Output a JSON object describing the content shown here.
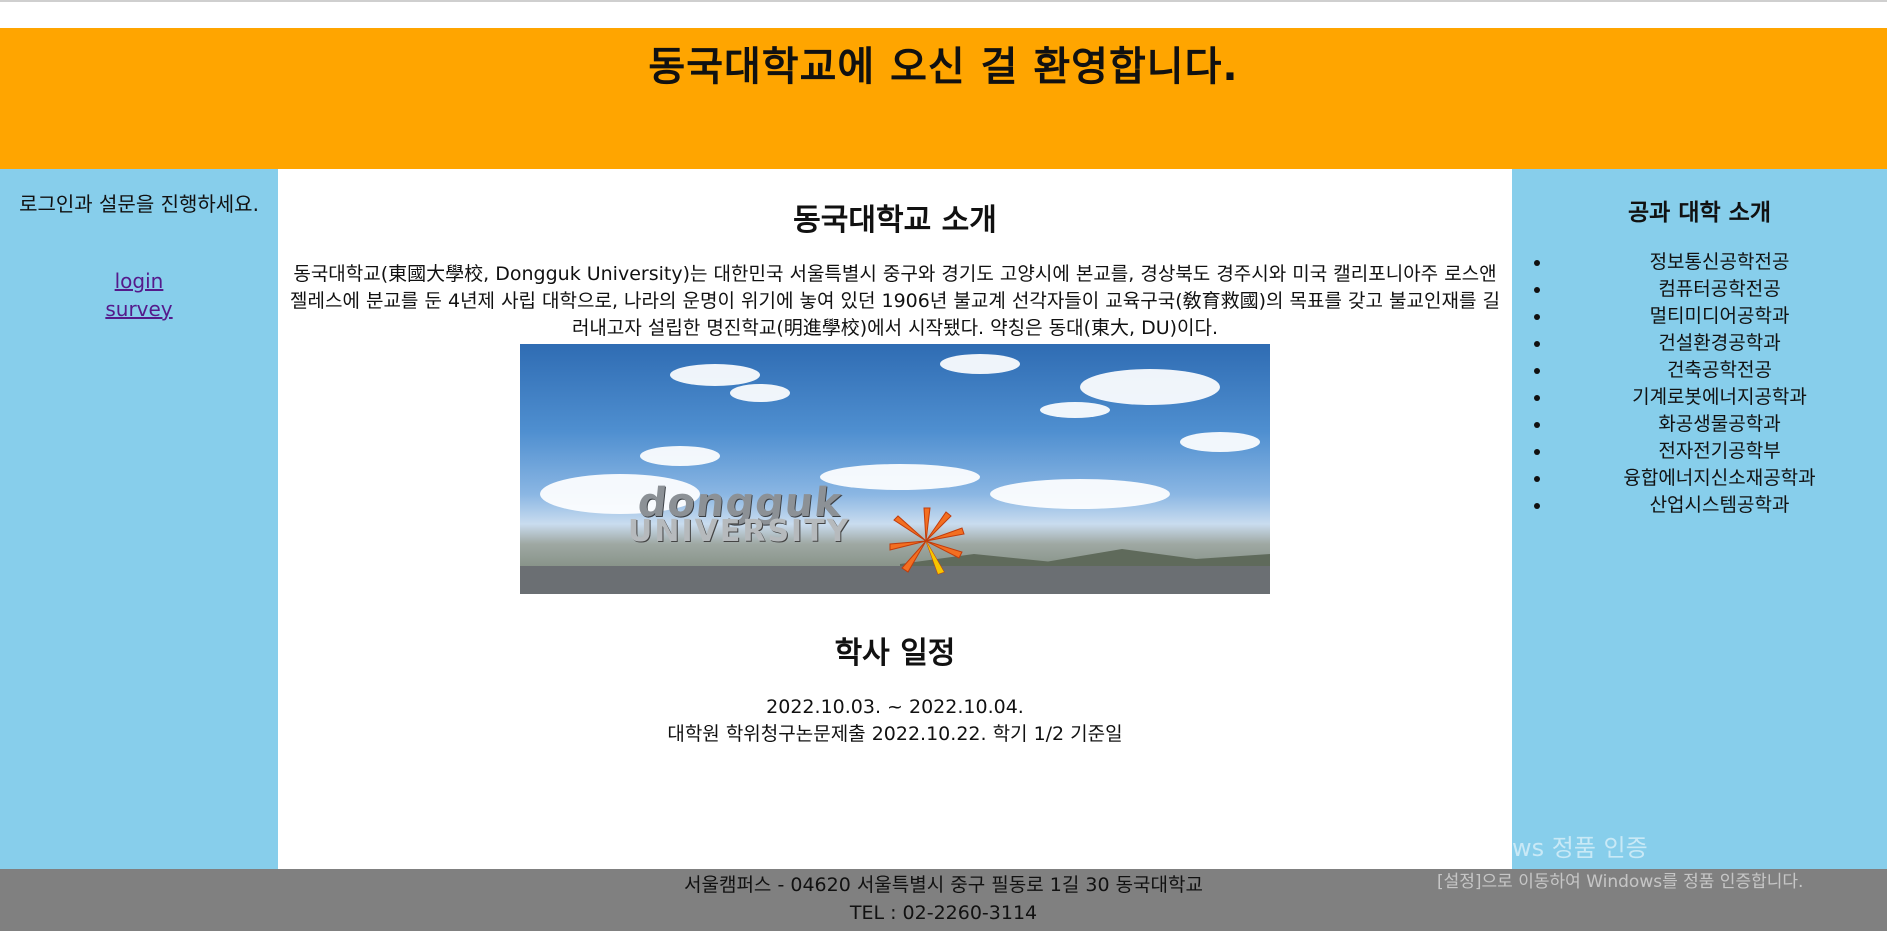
{
  "header": {
    "title": "동국대학교에 오신 걸 환영합니다."
  },
  "left": {
    "message": "로그인과 설문을 진행하세요.",
    "links": [
      "login",
      "survey"
    ]
  },
  "main": {
    "intro_title": "동국대학교 소개",
    "intro_text": "동국대학교(東國大學校, Dongguk University)는 대한민국 서울특별시 중구와 경기도 고양시에 본교를, 경상북도 경주시와 미국 캘리포니아주 로스앤젤레스에 분교를 둔 4년제 사립 대학으로, 나라의 운명이 위기에 놓여 있던 1906년 불교계 선각자들이 교육구국(敎育救國)의 목표를 갖고 불교인재를 길러내고자 설립한 명진학교(明進學校)에서 시작됐다. 약칭은 동대(東大, DU)이다.",
    "photo_sign": "dongguk",
    "photo_sign_2": "UNIVERSITY",
    "schedule_title": "학사 일정",
    "schedule_lines": [
      "2022.10.03. ~ 2022.10.04.",
      "대학원 학위청구논문제출 2022.10.22. 학기 1/2 기준일"
    ]
  },
  "right": {
    "title": "공과 대학 소개",
    "departments": [
      "정보통신공학전공",
      "컴퓨터공학전공",
      "멀티미디어공학과",
      "건설환경공학과",
      "건축공학전공",
      "기계로봇에너지공학과",
      "화공생물공학과",
      "전자전기공학부",
      "융합에너지신소재공학과",
      "산업시스템공학과"
    ]
  },
  "footer": {
    "address": "서울캠퍼스 - 04620 서울특별시 중구 필동로 1길 30 동국대학교",
    "tel": "TEL : 02-2260-3114"
  },
  "watermark": {
    "line1": "Windows 정품 인증",
    "line2": "[설정]으로 이동하여 Windows를 정품 인증합니다."
  },
  "colors": {
    "header_bg": "#ffa500",
    "sidebar_bg": "#87ceeb",
    "footer_bg": "#808080",
    "link": "#551a8b"
  }
}
